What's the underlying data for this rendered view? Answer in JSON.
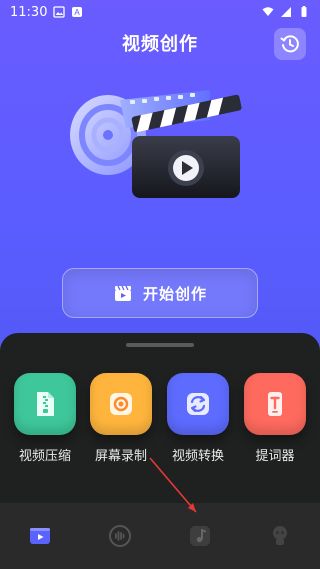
{
  "status_bar": {
    "time": "11:30"
  },
  "header": {
    "title": "视频创作"
  },
  "start_button": {
    "label": "开始创作"
  },
  "tools": [
    {
      "label": "视频压缩",
      "color": "#3ec79a",
      "icon": "zip-file-icon"
    },
    {
      "label": "屏幕录制",
      "color": "#ffb53d",
      "icon": "screen-record-icon"
    },
    {
      "label": "视频转换",
      "color": "#5d6bff",
      "icon": "convert-icon"
    },
    {
      "label": "提词器",
      "color": "#ff6a5e",
      "icon": "teleprompter-icon"
    }
  ],
  "bottom_nav": [
    {
      "icon": "video-tab-icon",
      "active": true
    },
    {
      "icon": "audio-tab-icon",
      "active": false
    },
    {
      "icon": "music-tab-icon",
      "active": false
    },
    {
      "icon": "profile-tab-icon",
      "active": false
    }
  ],
  "colors": {
    "background": "#5a5dff",
    "sheet": "#1f2020",
    "nav": "#2a2a2a",
    "annotation": "#e53935"
  }
}
